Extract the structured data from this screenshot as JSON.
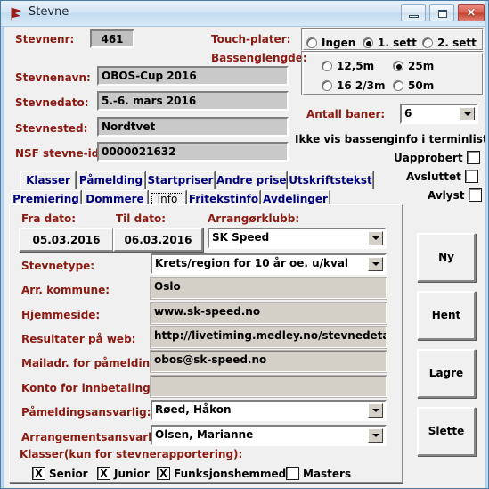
{
  "window": {
    "title": "Stevne",
    "icon": "flag-icon",
    "minimize_label": "Minimize",
    "maximize_label": "Maximize",
    "close_label": "×"
  },
  "header": {
    "stevnenr_label": "Stevnenr:",
    "stevnenr_value": "461",
    "stevnenavn_label": "Stevnenavn:",
    "stevnenavn_value": "OBOS-Cup 2016",
    "stevnedato_label": "Stevnedato:",
    "stevnedato_value": "5.-6. mars 2016",
    "stevnested_label": "Stevnested:",
    "stevnested_value": "Nordtvet",
    "nsf_id_label": "NSF stevne-id:",
    "nsf_id_value": "0000021632"
  },
  "touchplater": {
    "label": "Touch-plater:",
    "options": [
      {
        "label": "Ingen",
        "selected": false
      },
      {
        "label": "1. sett",
        "selected": true
      },
      {
        "label": "2. sett",
        "selected": false
      }
    ]
  },
  "bassenglengde": {
    "label": "Bassenglengde:",
    "options": [
      {
        "label": "12,5m",
        "selected": false
      },
      {
        "label": "25m",
        "selected": true
      },
      {
        "label": "16 2/3m",
        "selected": false
      },
      {
        "label": "50m",
        "selected": false
      }
    ]
  },
  "antall_baner": {
    "label": "Antall baner:",
    "value": "6"
  },
  "flags": [
    {
      "label": "Ikke vis bassenginfo i terminlisten",
      "checked": false
    },
    {
      "label": "Uapprobert",
      "checked": false
    },
    {
      "label": "Avsluttet",
      "checked": false
    },
    {
      "label": "Avlyst",
      "checked": false
    }
  ],
  "tabs": {
    "row1": [
      {
        "label": "Klasser",
        "selected": false
      },
      {
        "label": "Påmelding",
        "selected": false
      },
      {
        "label": "Startpriser",
        "selected": false
      },
      {
        "label": "Andre priser",
        "selected": false
      },
      {
        "label": "Utskriftstekst",
        "selected": false
      }
    ],
    "row2": [
      {
        "label": "Premiering",
        "selected": false
      },
      {
        "label": "Dommere",
        "selected": false
      },
      {
        "label": "Info",
        "selected": true
      },
      {
        "label": "Fritekstinfo",
        "selected": false
      },
      {
        "label": "Avdelinger",
        "selected": false
      }
    ]
  },
  "info_tab": {
    "fra_dato_label": "Fra dato:",
    "fra_dato_value": "05.03.2016",
    "til_dato_label": "Til dato:",
    "til_dato_value": "06.03.2016",
    "arrangorklubb_label": "Arrangørklubb:",
    "arrangorklubb_value": "SK Speed",
    "stevnetype_label": "Stevnetype:",
    "stevnetype_value": "Krets/region for 10 år oe. u/kval",
    "kommune_label": "Arr. kommune:",
    "kommune_value": "Oslo",
    "hjemmeside_label": "Hjemmeside:",
    "hjemmeside_value": "www.sk-speed.no",
    "resultater_label": "Resultater på web:",
    "resultater_value": "http://livetiming.medley.no/stevnedetaljer.as",
    "mailadr_label": "Mailadr. for påmeldinger:",
    "mailadr_value": "obos@sk-speed.no",
    "konto_label": "Konto for innbetalinger:",
    "konto_value": "",
    "pamelding_ansv_label": "Påmeldingsansvarlig:",
    "pamelding_ansv_value": "Røed, Håkon",
    "arrangement_ansv_label": "Arrangementsansvarlig:",
    "arrangement_ansv_value": "Olsen, Marianne",
    "klasser_label": "Klasser(kun for stevnerapportering):",
    "klasser": [
      {
        "label": "Senior",
        "checked": true
      },
      {
        "label": "Junior",
        "checked": true
      },
      {
        "label": "Funksjonshemmede",
        "checked": true
      },
      {
        "label": "Masters",
        "checked": false
      }
    ]
  },
  "actions": [
    {
      "label": "Ny"
    },
    {
      "label": "Hent"
    },
    {
      "label": "Lagre"
    },
    {
      "label": "Slette"
    }
  ],
  "colors": {
    "label_red": "#8b1a11",
    "tab_blue": "#00007c",
    "face": "#f0f0f0",
    "field_gray": "#c9c9c9"
  }
}
